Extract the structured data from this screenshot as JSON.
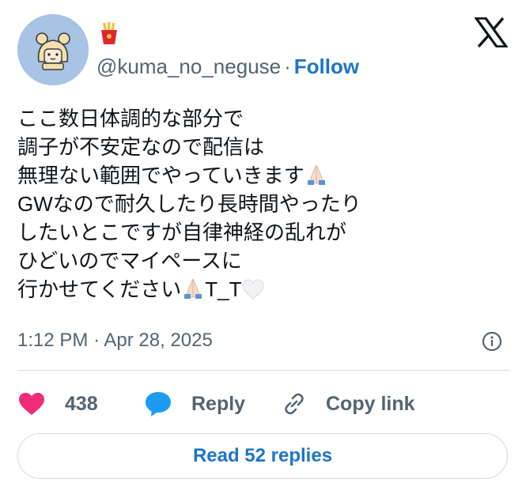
{
  "author": {
    "name_emoji": "french-fries-emoji",
    "handle": "@kuma_no_neguse",
    "separator": "·",
    "follow_label": "Follow",
    "avatar_icon": "bear-girl-avatar"
  },
  "brand": {
    "icon": "x-logo-icon"
  },
  "tweet": {
    "lines": [
      "ここ数日体調的な部分で",
      "調子が不安定なので配信は",
      "無理ない範囲でやっていきます",
      "GWなので耐久したり長時間やったり",
      "したいとこですが自律神経の乱れが",
      "ひどいのでマイペースに",
      "行かせてください"
    ],
    "line3_emoji": "folded-hands-emoji",
    "line7_emoji": "folded-hands-emoji",
    "line7_tail": "T_T",
    "line7_tail_emoji": "white-heart-emoji"
  },
  "meta": {
    "time": "1:12 PM",
    "separator": "·",
    "date": "Apr 28, 2025",
    "info_icon": "info-icon"
  },
  "actions": {
    "likes": "438",
    "reply_label": "Reply",
    "copy_label": "Copy link"
  },
  "footer": {
    "read_replies_label": "Read 52 replies"
  },
  "colors": {
    "accent": "#1d75c8",
    "like": "#f02b77",
    "reply_icon": "#1d9bf0",
    "muted": "#536471",
    "avatar_bg": "#a8c3e3"
  }
}
